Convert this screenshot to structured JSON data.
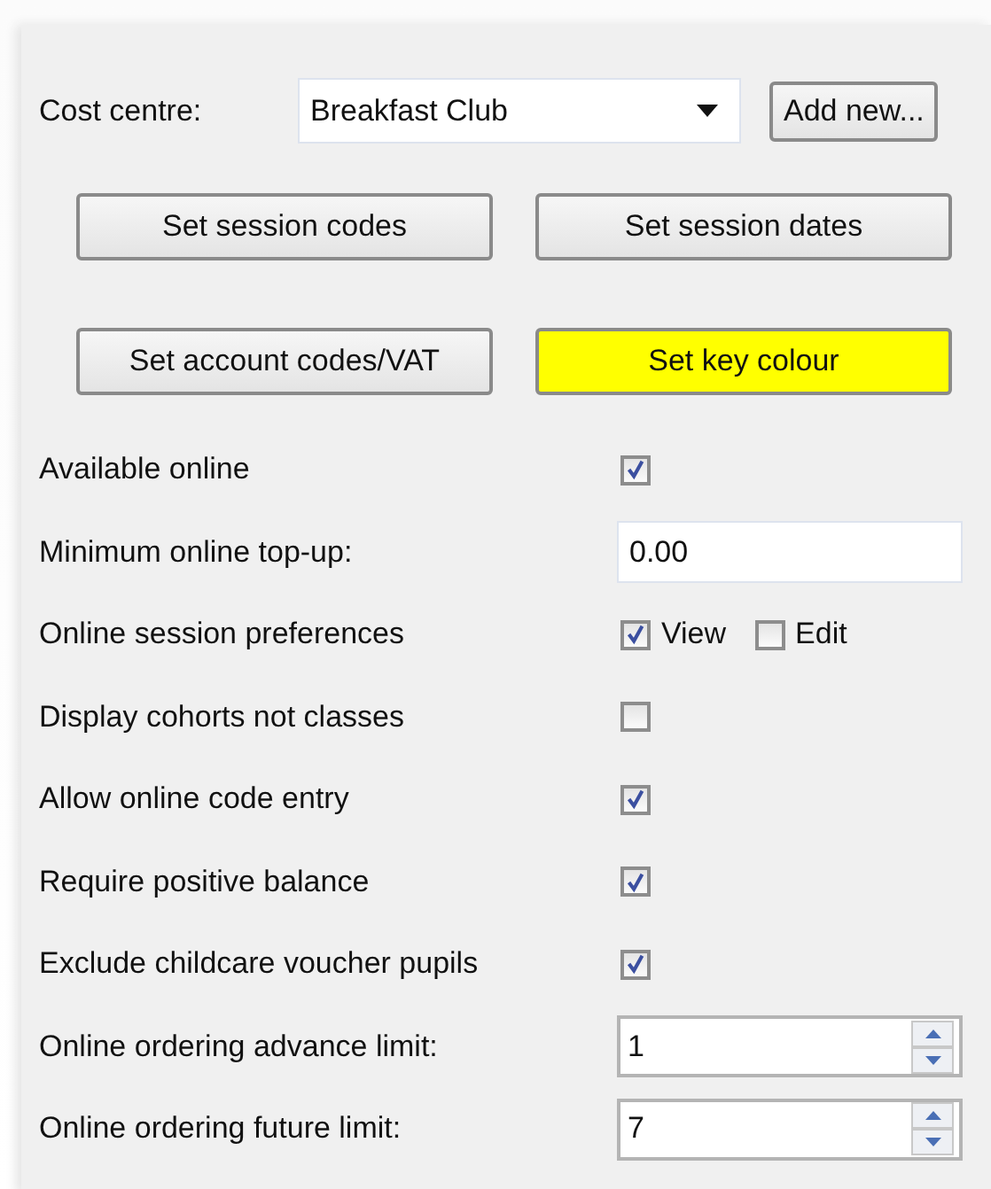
{
  "cost_centre": {
    "label": "Cost centre:",
    "value": "Breakfast Club",
    "button": "Add new..."
  },
  "buttons": [
    {
      "label": "Set session codes",
      "highlighted": false
    },
    {
      "label": "Set session dates",
      "highlighted": false
    },
    {
      "label": "Set account codes/VAT",
      "highlighted": false
    },
    {
      "label": "Set key colour",
      "highlighted": true
    }
  ],
  "settings": [
    {
      "kind": "checkbox",
      "label": "Available online",
      "checked": true
    },
    {
      "kind": "text",
      "label": "Minimum online top-up:",
      "value": "0.00"
    },
    {
      "kind": "checkpair",
      "label": "Online session preferences",
      "options": [
        {
          "label": "View",
          "checked": true
        },
        {
          "label": "Edit",
          "checked": false
        }
      ]
    },
    {
      "kind": "checkbox",
      "label": "Display cohorts not classes",
      "checked": false
    },
    {
      "kind": "checkbox",
      "label": "Allow online code entry",
      "checked": true
    },
    {
      "kind": "checkbox",
      "label": "Require positive balance",
      "checked": true
    },
    {
      "kind": "checkbox",
      "label": "Exclude childcare voucher pupils",
      "checked": true
    },
    {
      "kind": "spinner",
      "label": "Online ordering advance limit:",
      "value": "1"
    },
    {
      "kind": "spinner",
      "label": "Online ordering future limit:",
      "value": "7"
    }
  ]
}
